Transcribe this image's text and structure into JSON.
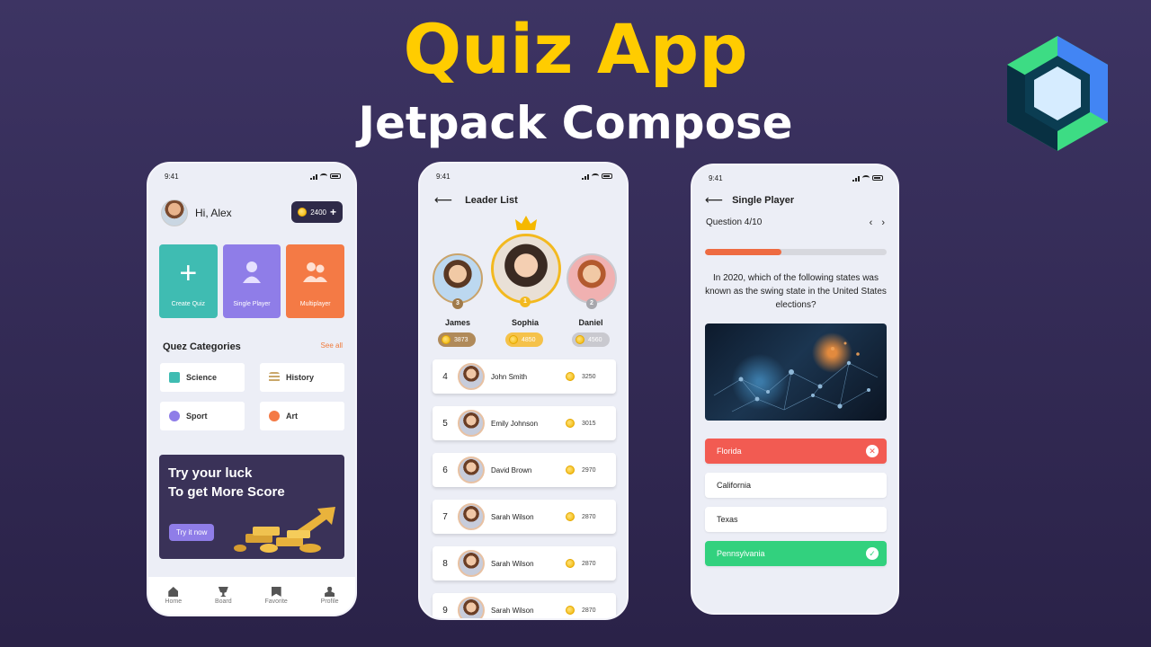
{
  "banner": {
    "title": "Quiz App",
    "subtitle": "Jetpack Compose"
  },
  "status_time": "9:41",
  "home": {
    "greeting": "Hi, Alex",
    "coins": "2400",
    "tiles": [
      {
        "label": "Create Quiz",
        "color": "#3fbcb2",
        "icon": "plus-icon"
      },
      {
        "label": "Single Player",
        "color": "#8f7de8",
        "icon": "person-icon"
      },
      {
        "label": "Multiplayer",
        "color": "#f47a45",
        "icon": "group-icon"
      }
    ],
    "categories_title": "Quez Categories",
    "see_all": "See all",
    "categories": [
      {
        "label": "Science",
        "icon": "trophy-icon",
        "color": "#3fbcb2"
      },
      {
        "label": "History",
        "icon": "list-icon",
        "color": "#c9a76a"
      },
      {
        "label": "Sport",
        "icon": "ball-icon",
        "color": "#8f7de8"
      },
      {
        "label": "Art",
        "icon": "palette-icon",
        "color": "#f47a45"
      }
    ],
    "promo_line1": "Try your luck",
    "promo_line2": "To get More Score",
    "promo_button": "Try it now",
    "nav": [
      "Home",
      "Board",
      "Favorite",
      "Profile"
    ]
  },
  "leaderboard": {
    "title": "Leader List",
    "podium": [
      {
        "name": "James",
        "score": "3873",
        "rank": "3",
        "pill_color": "#b08a5a"
      },
      {
        "name": "Sophia",
        "score": "4850",
        "rank": "1",
        "pill_color": "#f5c24a"
      },
      {
        "name": "Daniel",
        "score": "4560",
        "rank": "2",
        "pill_color": "#c9c9cf"
      }
    ],
    "rows": [
      {
        "rank": "4",
        "name": "John Smith",
        "score": "3250"
      },
      {
        "rank": "5",
        "name": "Emily Johnson",
        "score": "3015"
      },
      {
        "rank": "6",
        "name": "David Brown",
        "score": "2970"
      },
      {
        "rank": "7",
        "name": "Sarah Wilson",
        "score": "2870"
      },
      {
        "rank": "8",
        "name": "Sarah Wilson",
        "score": "2870"
      },
      {
        "rank": "9",
        "name": "Sarah Wilson",
        "score": "2870"
      }
    ]
  },
  "single": {
    "title": "Single Player",
    "question_label": "Question 4/10",
    "progress": 0.42,
    "question": "In 2020, which of the following states was known as the swing state in the United States elections?",
    "options": [
      {
        "label": "Florida",
        "state": "wrong"
      },
      {
        "label": "California",
        "state": "none"
      },
      {
        "label": "Texas",
        "state": "none"
      },
      {
        "label": "Pennsylvania",
        "state": "right"
      }
    ]
  }
}
